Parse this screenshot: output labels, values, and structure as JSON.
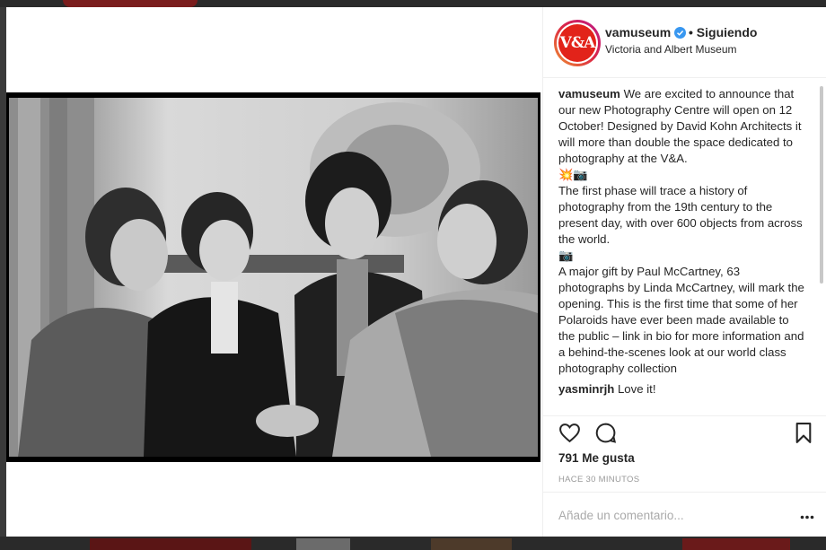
{
  "post": {
    "username": "vamuseum",
    "verified": true,
    "separator": "•",
    "follow_status": "Siguiendo",
    "account_name": "Victoria and Albert Museum",
    "avatar_text": "V&A",
    "caption_username": "vamuseum",
    "caption_lines": [
      " We are excited to announce that our new Photography Centre will open on 12 October! Designed by David Kohn Architects it will more than double the space dedicated to photography at the V&A.",
      "💥📷",
      "The first phase will trace a history of photography from the 19th century to the present day, with over 600 objects from across the world.",
      "📷",
      "A major gift by Paul McCartney, 63 photographs by Linda McCartney, will mark the opening. This is the first time that some of her Polaroids have ever been made available to the public – link in bio for more information and a behind-the-scenes look at our world class photography collection"
    ],
    "comments": [
      {
        "username": "yasminrjh",
        "text": " Love it!"
      }
    ],
    "likes": "791 Me gusta",
    "time_ago": "HACE 30 MINUTOS",
    "comment_placeholder": "Añade un comentario...",
    "icons": [
      "verified-badge-icon",
      "heart-icon",
      "comment-icon",
      "bookmark-icon",
      "more-options-icon"
    ],
    "colors": {
      "verified": "#3897f0",
      "avatar_bg": "#e2231a",
      "muted": "#999999"
    }
  }
}
